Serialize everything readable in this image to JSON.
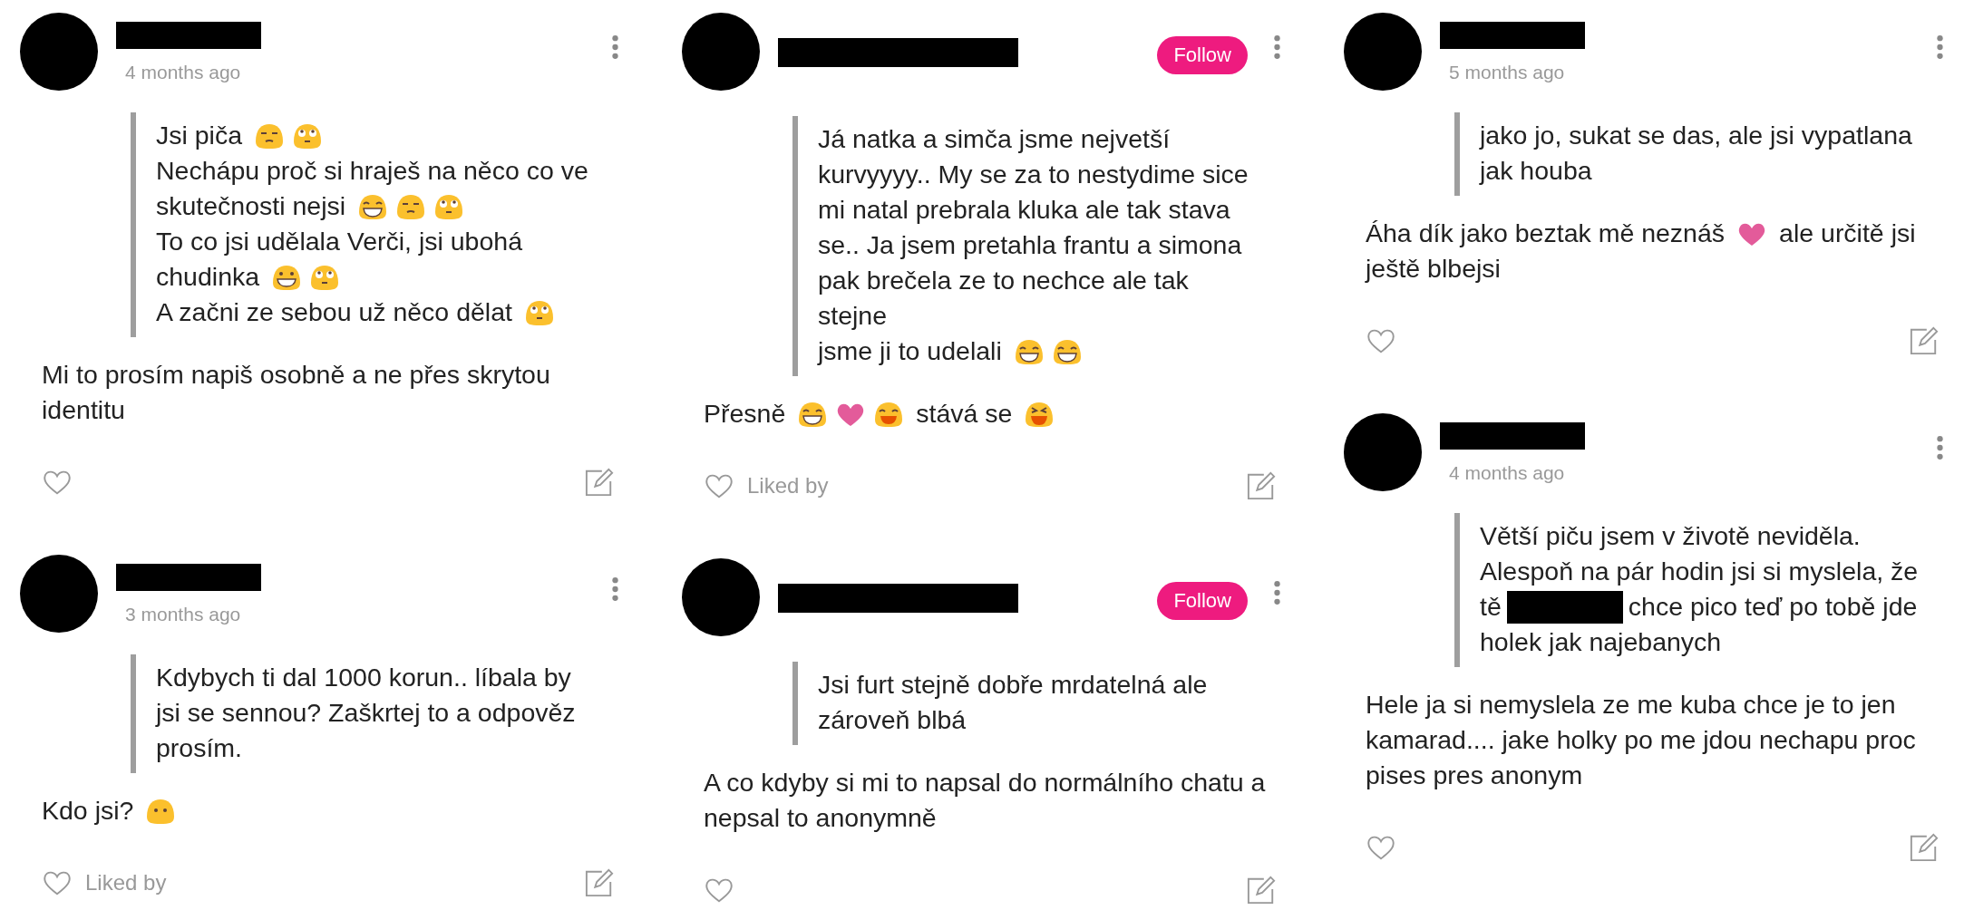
{
  "columns": [
    {
      "cards": [
        {
          "time": "4 months ago",
          "question": [
            [
              {
                "kind": "text",
                "text": "Jsi piča"
              },
              {
                "kind": "unamused"
              },
              {
                "kind": "eyeroll"
              }
            ],
            [
              {
                "kind": "text",
                "text": "Nechápu proč si hraješ na něco co ve"
              }
            ],
            [
              {
                "kind": "text",
                "text": "skutečnosti nejsi"
              },
              {
                "kind": "laughing"
              },
              {
                "kind": "unamused"
              },
              {
                "kind": "eyeroll"
              }
            ],
            [
              {
                "kind": "text",
                "text": "To co jsi udělala Verči, jsi ubohá"
              }
            ],
            [
              {
                "kind": "text",
                "text": "chudinka"
              },
              {
                "kind": "grin"
              },
              {
                "kind": "eyeroll"
              }
            ],
            [
              {
                "kind": "text",
                "text": "A začni ze sebou už něco dělat"
              },
              {
                "kind": "eyeroll"
              }
            ]
          ],
          "answer": [
            [
              {
                "kind": "text",
                "text": "Mi to prosím napiš osobně a ne přes skrytou identitu"
              }
            ]
          ]
        },
        {
          "time": "3 months ago",
          "question": [
            [
              {
                "kind": "text",
                "text": "Kdybych ti dal 1000 korun.. líbala by jsi se sennou? Zaškrtej to a odpověz prosím."
              }
            ]
          ],
          "answer": [
            [
              {
                "kind": "text",
                "text": "Kdo jsi?"
              },
              {
                "kind": "nomouth"
              }
            ]
          ],
          "liked_by": "Liked by"
        }
      ]
    },
    {
      "cards": [
        {
          "follow_button": "Follow",
          "question": [
            [
              {
                "kind": "text",
                "text": "Já natka a simča jsme nejvetší kurvyyyy.. My se za to nestydime sice mi natal prebrala kluka ale tak stava se.. Ja jsem pretahla frantu a simona pak brečela ze to nechce ale tak stejne"
              }
            ],
            [
              {
                "kind": "text",
                "text": "jsme ji to udelali"
              },
              {
                "kind": "laughing"
              },
              {
                "kind": "laughing"
              }
            ]
          ],
          "answer": [
            [
              {
                "kind": "text",
                "text": "Přesně"
              },
              {
                "kind": "laughing"
              },
              {
                "kind": "heart"
              },
              {
                "kind": "smile"
              },
              {
                "kind": "text",
                "text": "stává se"
              },
              {
                "kind": "rofl"
              }
            ]
          ],
          "liked_by": "Liked by"
        },
        {
          "follow_button": "Follow",
          "question": [
            [
              {
                "kind": "text",
                "text": "Jsi furt stejně dobře mrdatelná ale zároveň blbá"
              }
            ]
          ],
          "answer": [
            [
              {
                "kind": "text",
                "text": "A co kdyby si mi to napsal do normálního chatu a nepsal to anonymně"
              }
            ]
          ]
        }
      ]
    },
    {
      "cards": [
        {
          "time": "5 months ago",
          "question": [
            [
              {
                "kind": "text",
                "text": "jako jo, sukat se das, ale jsi vypatlana jak houba"
              }
            ]
          ],
          "answer": [
            [
              {
                "kind": "text",
                "text": "Áha dík jako beztak mě neznáš"
              },
              {
                "kind": "heart"
              },
              {
                "kind": "text",
                "text": "ale určitě jsi"
              }
            ],
            [
              {
                "kind": "text",
                "text": "ještě blbejsi"
              }
            ]
          ]
        },
        {
          "time": "4 months ago",
          "question": [
            [
              {
                "kind": "text",
                "text": "Větší piču jsem v životě neviděla."
              }
            ],
            [
              {
                "kind": "text",
                "text": "Alespoň na pár hodin jsi si myslela, že"
              }
            ],
            [
              {
                "kind": "text",
                "text": "tě"
              },
              {
                "kind": "redacted"
              },
              {
                "kind": "text",
                "text": "chce pico teď po tobě jde"
              }
            ],
            [
              {
                "kind": "text",
                "text": "holek jak najebanych"
              }
            ]
          ],
          "answer": [
            [
              {
                "kind": "text",
                "text": "Hele ja si nemyslela ze me kuba chce je to jen kamarad.... jake holky po me jdou nechapu proc pises pres anonym"
              }
            ]
          ]
        }
      ]
    }
  ]
}
